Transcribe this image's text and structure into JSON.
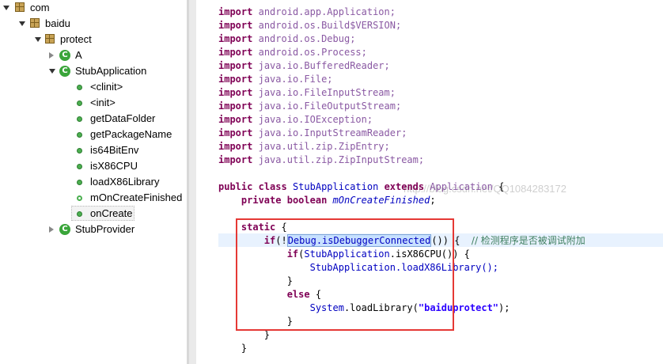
{
  "tree": {
    "items": [
      {
        "label": "com",
        "icon": "package-icon",
        "toggle": "expanded",
        "depth": 0
      },
      {
        "label": "baidu",
        "icon": "package-icon",
        "toggle": "expanded",
        "depth": 1
      },
      {
        "label": "protect",
        "icon": "package-icon",
        "toggle": "expanded",
        "depth": 2
      },
      {
        "label": "A",
        "icon": "class-icon",
        "toggle": "collapsed",
        "depth": 3
      },
      {
        "label": "StubApplication",
        "icon": "class-icon",
        "toggle": "expanded",
        "depth": 3
      },
      {
        "label": "<clinit>",
        "icon": "method-icon",
        "depth": 4
      },
      {
        "label": "<init>",
        "icon": "method-icon",
        "depth": 4
      },
      {
        "label": "getDataFolder",
        "icon": "method-icon",
        "depth": 4
      },
      {
        "label": "getPackageName",
        "icon": "method-icon",
        "depth": 4
      },
      {
        "label": "is64BitEnv",
        "icon": "method-icon",
        "depth": 4
      },
      {
        "label": "isX86CPU",
        "icon": "method-icon",
        "depth": 4
      },
      {
        "label": "loadX86Library",
        "icon": "method-icon",
        "depth": 4
      },
      {
        "label": "mOnCreateFinished",
        "icon": "field-icon",
        "depth": 4
      },
      {
        "label": "onCreate",
        "icon": "method-icon",
        "depth": 4,
        "selected": true
      },
      {
        "label": "StubProvider",
        "icon": "class-icon",
        "toggle": "collapsed",
        "depth": 3
      }
    ],
    "class_icon_letter": "C"
  },
  "editor": {
    "imports": [
      "android.app.Application;",
      "android.os.Build$VERSION;",
      "android.os.Debug;",
      "android.os.Process;",
      "java.io.BufferedReader;",
      "java.io.File;",
      "java.io.FileInputStream;",
      "java.io.FileOutputStream;",
      "java.io.IOException;",
      "java.io.InputStreamReader;",
      "java.util.zip.ZipEntry;",
      "java.util.zip.ZipInputStream;"
    ],
    "kw_import": "import",
    "kw_public": "public",
    "kw_class": "class",
    "class_name": "StubApplication",
    "kw_extends": "extends",
    "superclass": "Application",
    "brace_open": "{",
    "brace_close": "}",
    "kw_private": "private",
    "kw_boolean": "boolean",
    "field_name": "mOnCreateFinished",
    "semicolon": ";",
    "kw_static": "static",
    "kw_if": "if",
    "if_open": "(!",
    "selected_text": "Debug.isDebuggerConnected",
    "if_close": "()) {",
    "comment": "// 检测程序是否被调试附加",
    "inner_if_arg": "StubApplication",
    "inner_if_rest": ".isX86CPU()) {",
    "paren_open": "(",
    "call1": "StubApplication.loadX86Library();",
    "kw_else": "else",
    "system_class": "System",
    "load_call": ".loadLibrary(",
    "lib_string": "\"baiduprotect\"",
    "load_end": ");",
    "watermark": "http://blog.csdn.net/QQ1084283172"
  },
  "colors": {
    "keyword": "#7f0055",
    "import_id": "#8a59a3",
    "type_ref": "#0000c0",
    "string": "#2a00ff",
    "comment": "#3f7f5f",
    "highlight_box": "#e53935"
  }
}
